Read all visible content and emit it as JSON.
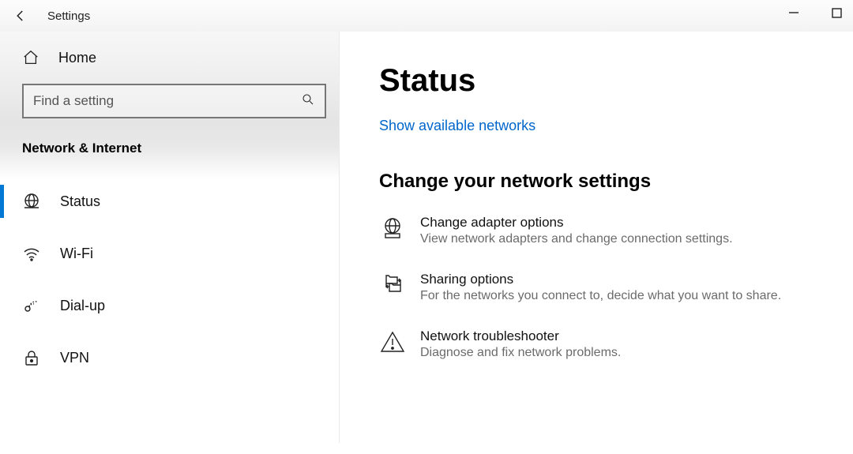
{
  "window": {
    "title": "Settings"
  },
  "sidebar": {
    "home": "Home",
    "search_placeholder": "Find a setting",
    "category": "Network & Internet",
    "items": [
      {
        "label": "Status"
      },
      {
        "label": "Wi-Fi"
      },
      {
        "label": "Dial-up"
      },
      {
        "label": "VPN"
      }
    ]
  },
  "main": {
    "title": "Status",
    "link": "Show available networks",
    "section_heading": "Change your network settings",
    "options": [
      {
        "title": "Change adapter options",
        "desc": "View network adapters and change connection settings."
      },
      {
        "title": "Sharing options",
        "desc": "For the networks you connect to, decide what you want to share."
      },
      {
        "title": "Network troubleshooter",
        "desc": "Diagnose and fix network problems."
      }
    ]
  }
}
